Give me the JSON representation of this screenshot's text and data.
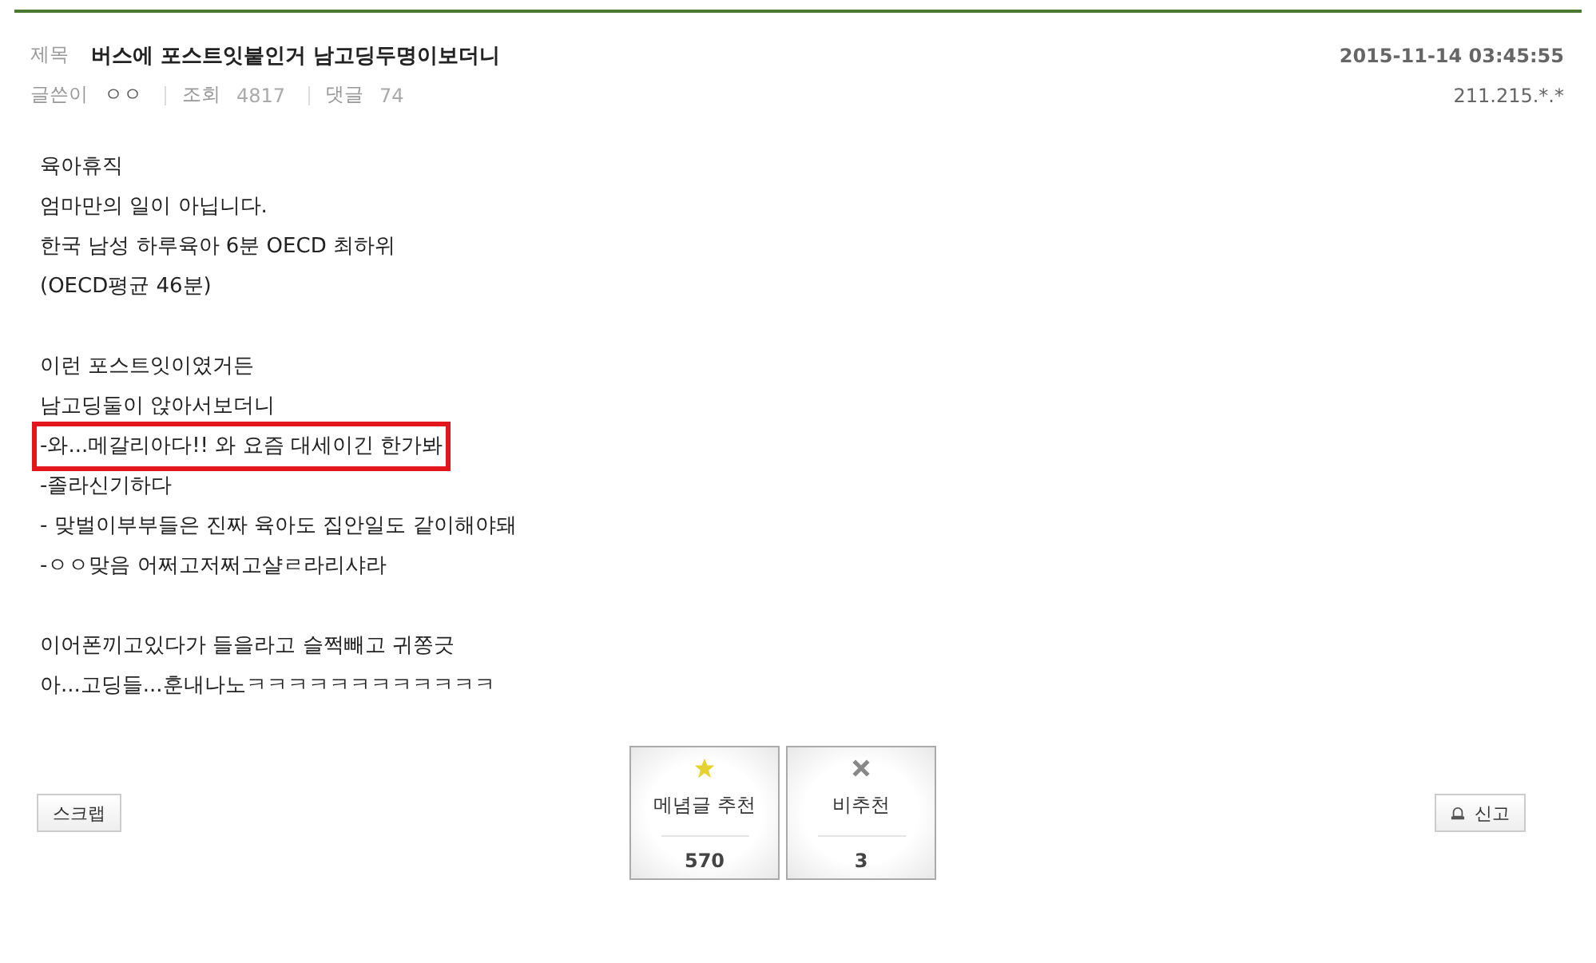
{
  "post": {
    "title_label": "제목",
    "title": "버스에 포스트잇붙인거 남고딩두명이보더니",
    "date": "2015-11-14 03:45:55",
    "meta": [
      {
        "label": "글쓴이",
        "value": "ㅇㅇ",
        "kind": "author"
      },
      {
        "label": "조회",
        "value": "4817",
        "kind": "count"
      },
      {
        "label": "댓글",
        "value": "74",
        "kind": "count"
      }
    ],
    "ip": "211.215.*.*"
  },
  "body": [
    [
      {
        "text": "육아휴직",
        "highlighted": false
      },
      {
        "text": "엄마만의 일이 아닙니다.",
        "highlighted": false
      },
      {
        "text": "한국 남성 하루육아 6분 OECD 최하위",
        "highlighted": false
      },
      {
        "text": "(OECD평균 46분)",
        "highlighted": false
      }
    ],
    [
      {
        "text": "이런 포스트잇이였거든",
        "highlighted": false
      },
      {
        "text": "남고딩둘이 앉아서보더니",
        "highlighted": false
      },
      {
        "text": "-와...메갈리아다!! 와 요즘 대세이긴 한가봐",
        "highlighted": true
      },
      {
        "text": "-졸라신기하다",
        "highlighted": false
      },
      {
        "text": "- 맞벌이부부들은 진짜 육아도 집안일도 같이해야돼",
        "highlighted": false
      },
      {
        "text": "-ㅇㅇ맞음 어쩌고저쩌고샬ㄹ라리샤라",
        "highlighted": false
      }
    ],
    [
      {
        "text": "이어폰끼고있다가 들을라고 슬쩍빼고 귀쫑긋",
        "highlighted": false
      },
      {
        "text": "아...고딩들...훈내나노ㅋㅋㅋㅋㅋㅋㅋㅋㅋㅋㅋㅋ",
        "highlighted": false
      }
    ]
  ],
  "scrap_button": "스크랩",
  "votes": [
    {
      "kind": "up",
      "label": "메념글 추천",
      "count": "570"
    },
    {
      "kind": "down",
      "label": "비추천",
      "count": "3"
    }
  ],
  "report_button": "신고"
}
